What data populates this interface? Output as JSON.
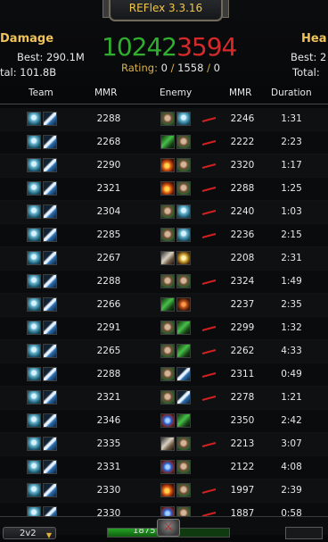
{
  "window": {
    "title": "REFlex 3.3.16"
  },
  "summary": {
    "damage": {
      "label": "Damage",
      "best": "290.1M",
      "total": "101.8B",
      "best_prefix": "Best:",
      "total_prefix": "tal:"
    },
    "healing": {
      "label": "Hea",
      "best": "2",
      "best_prefix": "Best:",
      "total_prefix": "Total:"
    },
    "wins": "1024",
    "middle_digit_green": "2",
    "middle_digit_red": "3",
    "losses": "594",
    "rating_label": "Rating:",
    "rating_current": "0",
    "rating_best": "1558",
    "rating_change": "0",
    "rating_sep": "/"
  },
  "columns": [
    "Team",
    "MMR",
    "Enemy",
    "MMR",
    "Duration"
  ],
  "rows": [
    {
      "team_icons": [
        "ic-orb",
        "ic-sword"
      ],
      "mmr": "2288",
      "enemy_icons": [
        "ic-orc",
        "ic-orb"
      ],
      "enemy_mmr": "2246",
      "duration": "1:31",
      "mark": "lose"
    },
    {
      "team_icons": [
        "ic-orb",
        "ic-sword"
      ],
      "mmr": "2268",
      "enemy_icons": [
        "ic-green",
        "ic-orc"
      ],
      "enemy_mmr": "2222",
      "duration": "2:23",
      "mark": "lose"
    },
    {
      "team_icons": [
        "ic-orb",
        "ic-sword"
      ],
      "mmr": "2290",
      "enemy_icons": [
        "ic-fire",
        "ic-orc"
      ],
      "enemy_mmr": "2320",
      "duration": "1:17",
      "mark": "lose"
    },
    {
      "team_icons": [
        "ic-orb",
        "ic-sword"
      ],
      "mmr": "2321",
      "enemy_icons": [
        "ic-fire",
        "ic-orc"
      ],
      "enemy_mmr": "2288",
      "duration": "1:25",
      "mark": "lose"
    },
    {
      "team_icons": [
        "ic-orb",
        "ic-sword"
      ],
      "mmr": "2304",
      "enemy_icons": [
        "ic-orc",
        "ic-orb"
      ],
      "enemy_mmr": "2240",
      "duration": "1:03",
      "mark": "lose"
    },
    {
      "team_icons": [
        "ic-orb",
        "ic-sword"
      ],
      "mmr": "2285",
      "enemy_icons": [
        "ic-orc",
        "ic-orb"
      ],
      "enemy_mmr": "2236",
      "duration": "2:15",
      "mark": "lose"
    },
    {
      "team_icons": [
        "ic-orb",
        "ic-sword"
      ],
      "mmr": "2267",
      "enemy_icons": [
        "ic-bone",
        "ic-gold"
      ],
      "enemy_mmr": "2208",
      "duration": "2:31",
      "mark": ""
    },
    {
      "team_icons": [
        "ic-orb",
        "ic-sword"
      ],
      "mmr": "2288",
      "enemy_icons": [
        "ic-orc",
        "ic-orc"
      ],
      "enemy_mmr": "2324",
      "duration": "1:49",
      "mark": "lose"
    },
    {
      "team_icons": [
        "ic-orb",
        "ic-sword"
      ],
      "mmr": "2266",
      "enemy_icons": [
        "ic-green",
        "ic-dots"
      ],
      "enemy_mmr": "2237",
      "duration": "2:35",
      "mark": ""
    },
    {
      "team_icons": [
        "ic-orb",
        "ic-sword"
      ],
      "mmr": "2291",
      "enemy_icons": [
        "ic-orc",
        "ic-green"
      ],
      "enemy_mmr": "2299",
      "duration": "1:32",
      "mark": "lose"
    },
    {
      "team_icons": [
        "ic-orb",
        "ic-sword"
      ],
      "mmr": "2265",
      "enemy_icons": [
        "ic-orc",
        "ic-green"
      ],
      "enemy_mmr": "2262",
      "duration": "4:33",
      "mark": "lose"
    },
    {
      "team_icons": [
        "ic-orb",
        "ic-sword"
      ],
      "mmr": "2288",
      "enemy_icons": [
        "ic-orc",
        "ic-sword"
      ],
      "enemy_mmr": "2311",
      "duration": "0:49",
      "mark": "lose"
    },
    {
      "team_icons": [
        "ic-orb",
        "ic-sword"
      ],
      "mmr": "2321",
      "enemy_icons": [
        "ic-orc",
        "ic-sword"
      ],
      "enemy_mmr": "2278",
      "duration": "1:21",
      "mark": "lose"
    },
    {
      "team_icons": [
        "ic-orb",
        "ic-sword"
      ],
      "mmr": "2346",
      "enemy_icons": [
        "ic-blue",
        "ic-green"
      ],
      "enemy_mmr": "2350",
      "duration": "2:42",
      "mark": ""
    },
    {
      "team_icons": [
        "ic-orb",
        "ic-sword"
      ],
      "mmr": "2335",
      "enemy_icons": [
        "ic-bone",
        "ic-orc"
      ],
      "enemy_mmr": "2213",
      "duration": "3:07",
      "mark": "lose"
    },
    {
      "team_icons": [
        "ic-orb",
        "ic-sword"
      ],
      "mmr": "2331",
      "enemy_icons": [
        "ic-blue",
        "ic-orc"
      ],
      "enemy_mmr": "2122",
      "duration": "4:08",
      "mark": ""
    },
    {
      "team_icons": [
        "ic-orb",
        "ic-sword"
      ],
      "mmr": "2330",
      "enemy_icons": [
        "ic-fire",
        "ic-orc"
      ],
      "enemy_mmr": "1997",
      "duration": "2:39",
      "mark": "lose"
    },
    {
      "team_icons": [
        "ic-orb",
        "ic-sword"
      ],
      "mmr": "2330",
      "enemy_icons": [
        "ic-blue",
        "ic-orc"
      ],
      "enemy_mmr": "1887",
      "duration": "0:58",
      "mark": "lose"
    }
  ],
  "footer": {
    "bracket": "2v2",
    "progress_text": "1875",
    "progress_value": "1875",
    "progress_fraction": 0.42
  },
  "colors": {
    "gold": "#f0c45a",
    "win": "#2fae2f",
    "loss": "#d62a2a",
    "mark": "#d42020"
  }
}
